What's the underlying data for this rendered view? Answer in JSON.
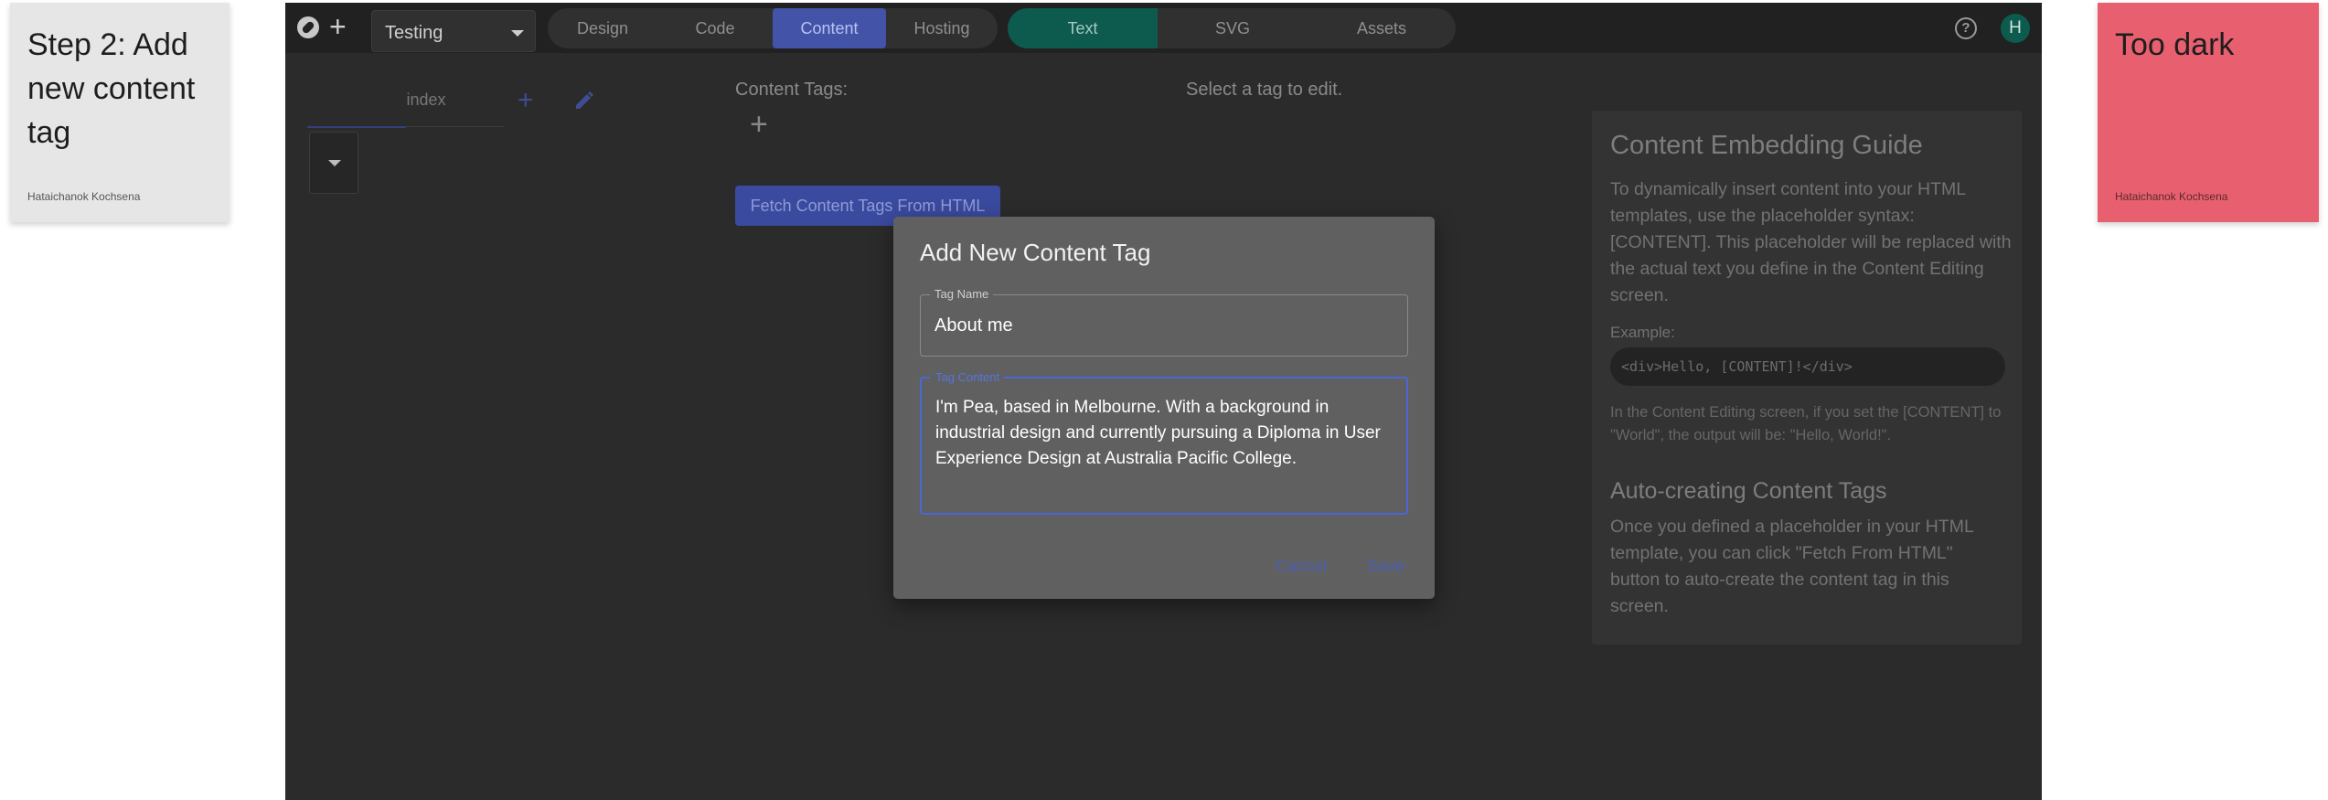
{
  "sticky_notes": {
    "step": {
      "title": "Step 2:  Add new content tag",
      "author": "Hataichanok Kochsena"
    },
    "feedback": {
      "title": "Too dark",
      "author": "Hataichanok Kochsena"
    }
  },
  "topbar": {
    "project": "Testing",
    "main_tabs": [
      "Design",
      "Code",
      "Content",
      "Hosting"
    ],
    "active_main_tab": "Content",
    "sub_tabs": [
      "Text",
      "SVG",
      "Assets"
    ],
    "active_sub_tab": "Text",
    "avatar_initial": "H"
  },
  "pages": {
    "items": [
      "index"
    ]
  },
  "content_tags": {
    "label": "Content Tags:",
    "fetch_button": "Fetch Content Tags From HTML",
    "select_hint": "Select a tag to edit."
  },
  "guide": {
    "title": "Content Embedding Guide",
    "intro": "To dynamically insert content into your HTML templates, use the placeholder syntax: [CONTENT]. This placeholder will be replaced with the actual text you define in the Content Editing screen.",
    "example_label": "Example:",
    "example_code": "<div>Hello, [CONTENT]!</div>",
    "example_note": "In the Content Editing screen, if you set the [CONTENT] to \"World\", the output will be: \"Hello, World!\".",
    "auto_title": "Auto-creating Content Tags",
    "auto_text": "Once you defined a placeholder in your HTML template, you can click \"Fetch From HTML\" button to auto-create the content tag in this screen."
  },
  "modal": {
    "title": "Add New Content Tag",
    "name_label": "Tag Name",
    "name_value": "About me",
    "content_label": "Tag Content",
    "content_value": "I'm Pea, based in Melbourne. With a background in industrial design and currently pursuing a Diploma in User Experience Design at Australia Pacific College.",
    "cancel_label": "Cancel",
    "save_label": "Save"
  },
  "colors": {
    "app_background": "#2b2b2b",
    "content_tab_active": "#4353a8",
    "text_tab_active": "#0d5a4e",
    "feedback_note": "#e8606f"
  }
}
